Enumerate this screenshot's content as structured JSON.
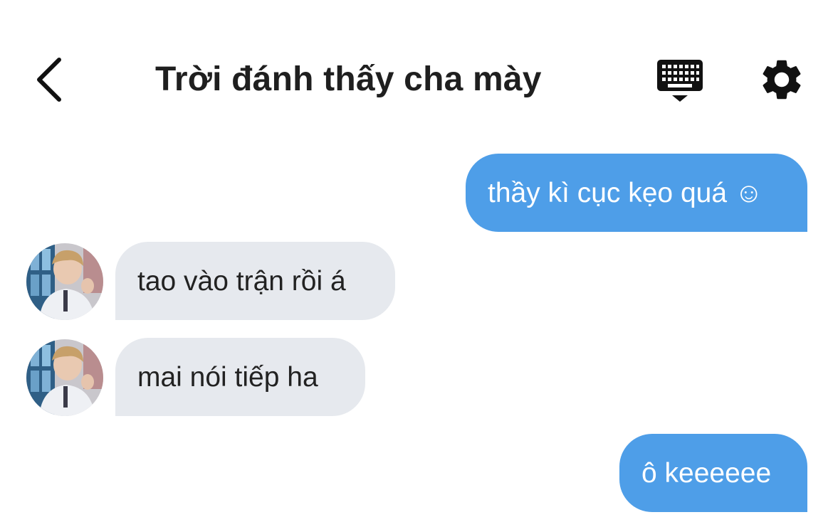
{
  "header": {
    "title": "Trời đánh thấy cha mày",
    "back_icon": "chevron-left-icon",
    "keyboard_icon": "keyboard-icon",
    "settings_icon": "gear-icon"
  },
  "messages": [
    {
      "direction": "sent",
      "text": "thầy kì cục kẹo quá ☺"
    },
    {
      "direction": "received",
      "text": "tao vào trận rồi á",
      "has_avatar": true
    },
    {
      "direction": "received",
      "text": "mai nói tiếp ha",
      "has_avatar": true
    },
    {
      "direction": "sent",
      "text": "ô keeeeee"
    }
  ],
  "colors": {
    "sent_bubble": "#4e9ee8",
    "received_bubble": "#e6e9ee",
    "header_text": "#1f1f1f"
  }
}
